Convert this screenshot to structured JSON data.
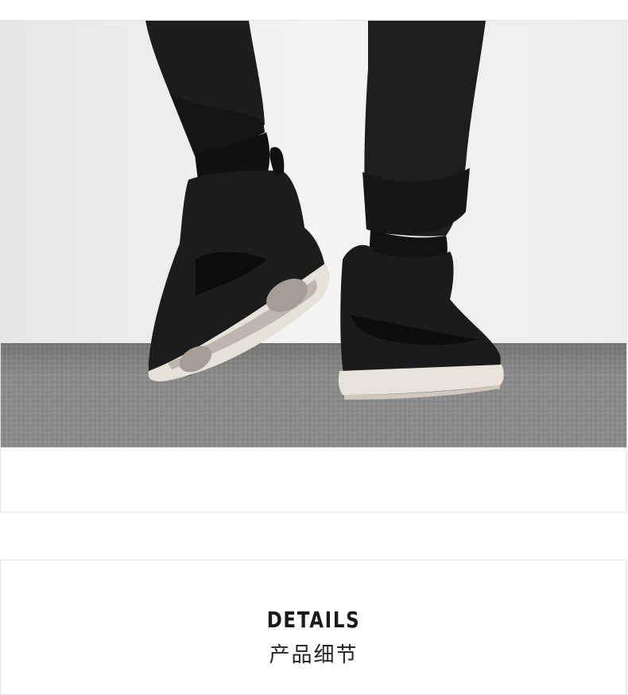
{
  "photo": {
    "alt_subject": "sneaker-photo",
    "colors": {
      "wall": "#efefef",
      "floor": "#8a8a8a",
      "shoe": "#1b1b1b",
      "sole": "#e9e4dc",
      "pants": "#1e1e1e"
    }
  },
  "details": {
    "title": "DETAILS",
    "subtitle": "产品细节"
  }
}
